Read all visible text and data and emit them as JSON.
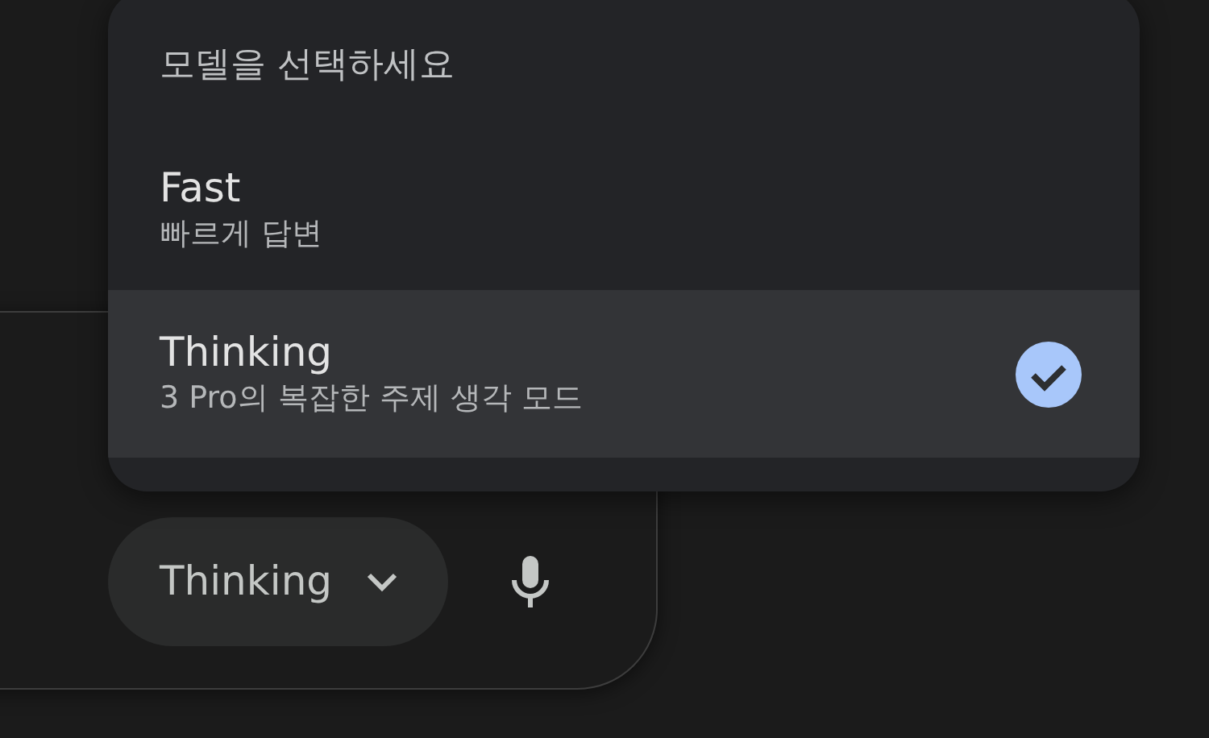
{
  "model_menu": {
    "title": "모델을 선택하세요",
    "items": [
      {
        "name": "Fast",
        "description": "빠르게 답변",
        "selected": false
      },
      {
        "name": "Thinking",
        "description": "3 Pro의 복잡한 주제 생각 모드",
        "selected": true
      }
    ]
  },
  "composer": {
    "mode_button": {
      "label": "Thinking"
    }
  }
}
